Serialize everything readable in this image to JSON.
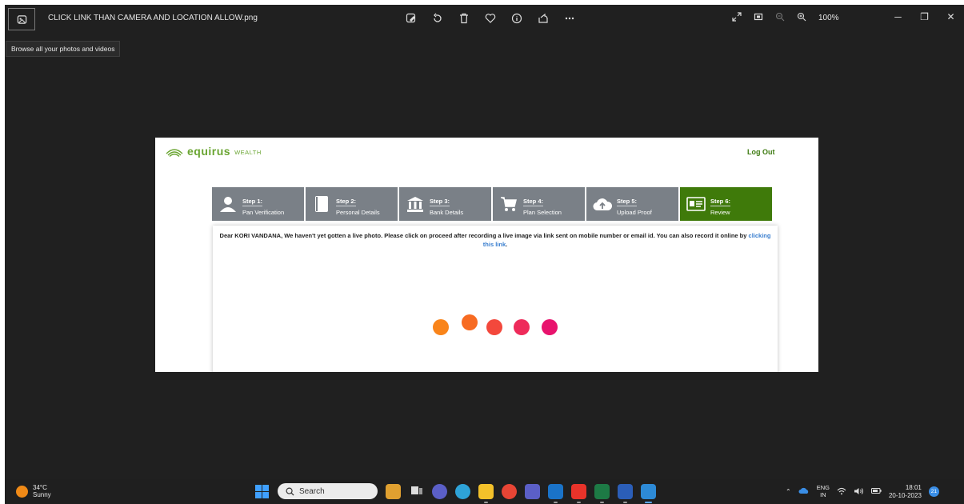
{
  "viewer": {
    "file_name": "CLICK LINK THAN CAMERA AND LOCATION ALLOW.png",
    "zoom": "100%",
    "tooltip": "Browse all your photos and videos"
  },
  "site": {
    "brand": "equirus",
    "brand_sub": "WEALTH",
    "logout": "Log Out",
    "steps": [
      {
        "title": "Step 1:",
        "label": "Pan Verification"
      },
      {
        "title": "Step 2:",
        "label": "Personal Details"
      },
      {
        "title": "Step 3:",
        "label": "Bank Details"
      },
      {
        "title": "Step 4:",
        "label": "Plan Selection"
      },
      {
        "title": "Step 5:",
        "label": "Upload Proof"
      },
      {
        "title": "Step 6:",
        "label": "Review"
      }
    ],
    "message": "Dear KORI VANDANA, We haven't yet gotten a live photo. Please click on proceed after recording a live image via link sent on mobile number or email id. You can also record it online by",
    "message_link": "clicking this link",
    "message_end": ".",
    "loader_colors": [
      "#f9841a",
      "#f76b22",
      "#f3483c",
      "#ee2b5a",
      "#e8136d"
    ]
  },
  "taskbar": {
    "temp": "34°C",
    "condition": "Sunny",
    "search_placeholder": "Search",
    "lang_1": "ENG",
    "lang_2": "IN",
    "time": "18:01",
    "date": "20-10-2023",
    "notif_count": "21"
  }
}
